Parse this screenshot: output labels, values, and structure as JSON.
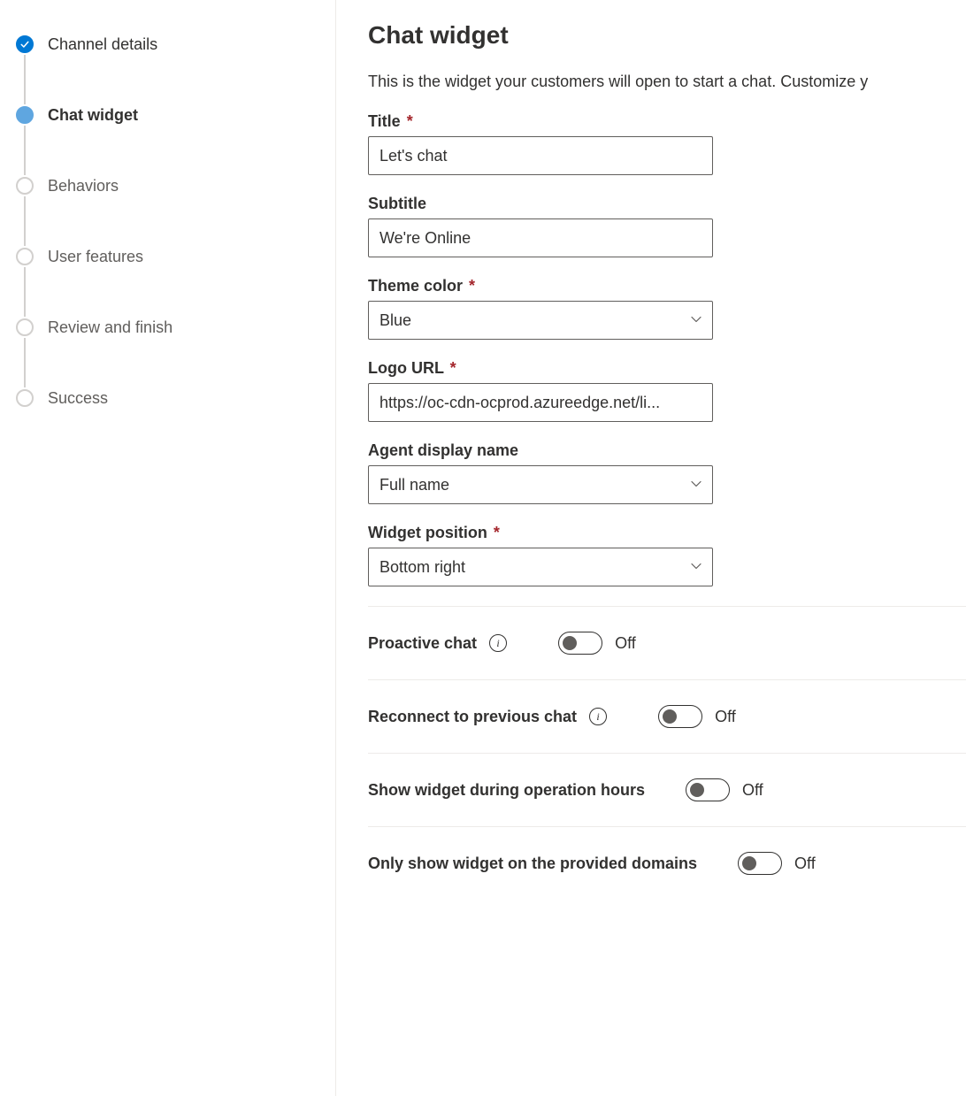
{
  "sidebar": {
    "steps": [
      {
        "label": "Channel details",
        "state": "completed"
      },
      {
        "label": "Chat widget",
        "state": "active"
      },
      {
        "label": "Behaviors",
        "state": "pending"
      },
      {
        "label": "User features",
        "state": "pending"
      },
      {
        "label": "Review and finish",
        "state": "pending"
      },
      {
        "label": "Success",
        "state": "pending"
      }
    ]
  },
  "main": {
    "title": "Chat widget",
    "description": "This is the widget your customers will open to start a chat. Customize y",
    "fields": {
      "title": {
        "label": "Title",
        "value": "Let's chat",
        "required": true
      },
      "subtitle": {
        "label": "Subtitle",
        "value": "We're Online",
        "required": false
      },
      "theme_color": {
        "label": "Theme color",
        "value": "Blue",
        "required": true
      },
      "logo_url": {
        "label": "Logo URL",
        "value": "https://oc-cdn-ocprod.azureedge.net/li...",
        "required": true
      },
      "agent_display_name": {
        "label": "Agent display name",
        "value": "Full name",
        "required": false
      },
      "widget_position": {
        "label": "Widget position",
        "value": "Bottom right",
        "required": true
      }
    },
    "toggles": {
      "proactive_chat": {
        "label": "Proactive chat",
        "state": "Off",
        "info": true
      },
      "reconnect": {
        "label": "Reconnect to previous chat",
        "state": "Off",
        "info": true
      },
      "operation_hours": {
        "label": "Show widget during operation hours",
        "state": "Off",
        "info": false
      },
      "domains": {
        "label": "Only show widget on the provided domains",
        "state": "Off",
        "info": false
      }
    },
    "required_mark": "*"
  }
}
